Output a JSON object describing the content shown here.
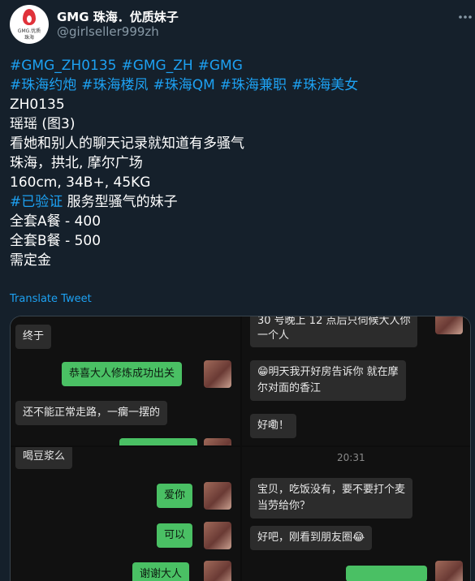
{
  "account": {
    "display_name": "GMG 珠海．优质妹子",
    "handle": "@girlseller999zh",
    "avatar_text_1": "GMG.优质",
    "avatar_text_2": "珠海"
  },
  "tweet": {
    "hashtags_row1": [
      "#GMG_ZH0135",
      "#GMG_ZH",
      "#GMG"
    ],
    "hashtags_row2": [
      "#珠海约炮",
      "#珠海楼凤",
      "#珠海QM",
      "#珠海兼职",
      "#珠海美女"
    ],
    "line_id": "ZH0135",
    "line_name": "瑶瑶 (图3)",
    "line_desc": "看她和别人的聊天记录就知道有多骚气",
    "line_location": "珠海，拱北, 摩尔广场",
    "line_stats": "160cm, 34B+, 45KG",
    "verified_tag": "#已验证",
    "verified_text": " 服务型骚气的妹子",
    "line_a": "全套A餐 - 400",
    "line_b": "全套B餐 - 500",
    "line_deposit": "需定金"
  },
  "translate_label": "Translate Tweet",
  "media": {
    "p1": {
      "m1": "终于",
      "m2": "恭喜大人修炼成功出关",
      "m3": "还不能正常走路，一瘸一摆的"
    },
    "p2": {
      "m1a": "30 号晚上 12 点后只伺候大人你",
      "m1b": "一个人",
      "m2a": "😁明天我开好房告诉你 就在摩",
      "m2b": "尔对面的香江",
      "m3": "好嘞！"
    },
    "p3": {
      "m1": "喝豆浆么",
      "m2": "爱你",
      "m3": "可以",
      "m4": "谢谢大人"
    },
    "p4": {
      "time": "20:31",
      "m1a": "宝贝，吃饭没有，要不要打个麦",
      "m1b": "当劳给你？",
      "m2": "好吧，刚看到朋友圈😂"
    }
  },
  "colors": {
    "background": "#15202b",
    "link": "#1da1f2",
    "secondary_text": "#8899a6",
    "chat_out": "#4ac064",
    "chat_in": "#2c2c2c"
  },
  "icons": [
    "more-options-icon"
  ]
}
